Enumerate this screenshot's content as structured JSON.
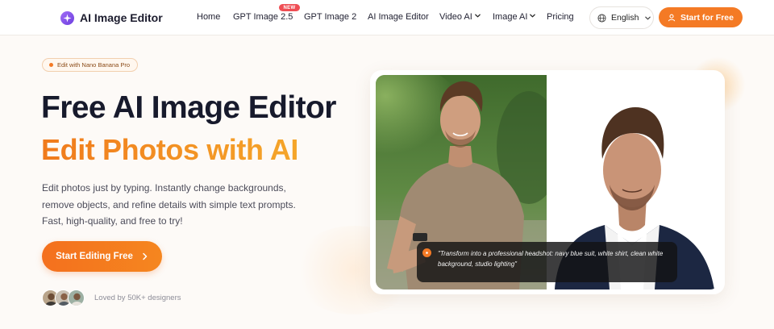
{
  "header": {
    "logo_text": "AI Image Editor",
    "nav": [
      {
        "label": "Home"
      },
      {
        "label": "GPT Image 2.5",
        "badge": "NEW"
      },
      {
        "label": "GPT Image 2"
      },
      {
        "label": "AI Image Editor"
      },
      {
        "label": "Video AI",
        "has_dropdown": true
      },
      {
        "label": "Image AI",
        "has_dropdown": true
      },
      {
        "label": "Pricing"
      }
    ],
    "language": "English",
    "cta_label": "Start for Free"
  },
  "hero": {
    "pill_label": "Edit with Nano Banana Pro",
    "title": "Free AI Image Editor",
    "subtitle": "Edit Photos with AI",
    "description_lines": [
      "Edit photos just by typing. Instantly change backgrounds,",
      "remove objects, and refine details with simple text prompts.",
      "Fast, high-quality, and free to try!"
    ],
    "cta_label": "Start Editing Free",
    "social_proof": "Loved by 50K+ designers"
  },
  "preview": {
    "prompt_text": "\"Transform into a professional headshot: navy blue suit, white shirt, clean white background, studio lighting\""
  },
  "colors": {
    "accent": "#f47a25",
    "gradient_start": "#f07a1c",
    "gradient_end": "#f5a62a",
    "title": "#171a2c",
    "new_badge": "#ef4e54",
    "logo": "#7a4ae6"
  },
  "icons": {
    "logo": "sparkle-icon",
    "language": "globe-icon",
    "cta_user": "person-icon",
    "cta_arrow": "chevron-right-icon",
    "dropdown": "chevron-down-icon"
  }
}
